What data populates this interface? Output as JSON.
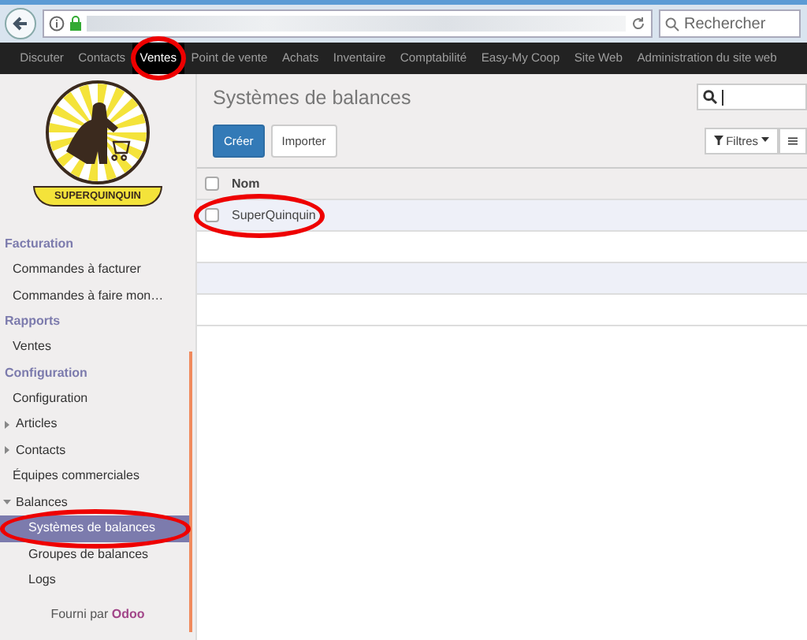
{
  "browser": {
    "search_placeholder": "Rechercher"
  },
  "navbar": {
    "items": [
      {
        "label": "Discuter",
        "selected": false,
        "circled": false
      },
      {
        "label": "Contacts",
        "selected": false,
        "circled": false
      },
      {
        "label": "Ventes",
        "selected": true,
        "circled": true
      },
      {
        "label": "Point de vente",
        "selected": false,
        "circled": false
      },
      {
        "label": "Achats",
        "selected": false,
        "circled": false
      },
      {
        "label": "Inventaire",
        "selected": false,
        "circled": false
      },
      {
        "label": "Comptabilité",
        "selected": false,
        "circled": false
      },
      {
        "label": "Easy-My Coop",
        "selected": false,
        "circled": false
      },
      {
        "label": "Site Web",
        "selected": false,
        "circled": false
      },
      {
        "label": "Administration du site web",
        "selected": false,
        "circled": false
      }
    ]
  },
  "sidebar": {
    "logo_text": "SUPERQUINQUIN",
    "sections": [
      {
        "title": "Facturation",
        "items": [
          {
            "label": "Commandes à facturer",
            "selected": false,
            "circled": false
          },
          {
            "label": "Commandes à faire mon…",
            "selected": false,
            "circled": false
          }
        ]
      },
      {
        "title": "Rapports",
        "items": [
          {
            "label": "Ventes",
            "selected": false,
            "circled": false
          }
        ]
      },
      {
        "title": "Configuration",
        "items": [
          {
            "label": "Configuration",
            "selected": false,
            "circled": false
          },
          {
            "label": "Articles",
            "selected": false,
            "circled": false,
            "expanded": false
          },
          {
            "label": "Contacts",
            "selected": false,
            "circled": false,
            "expanded": false
          },
          {
            "label": "Équipes commerciales",
            "selected": false,
            "circled": false
          },
          {
            "label": "Balances",
            "selected": false,
            "circled": false,
            "expanded": true,
            "children": [
              {
                "label": "Systèmes de balances",
                "selected": true,
                "circled": true
              },
              {
                "label": "Groupes de balances",
                "selected": false,
                "circled": false
              },
              {
                "label": "Logs",
                "selected": false,
                "circled": false
              }
            ]
          }
        ]
      }
    ],
    "footer": {
      "prefix": "Fourni par",
      "brand": "Odoo"
    }
  },
  "main": {
    "title": "Systèmes de balances",
    "buttons": [
      {
        "label": "Créer",
        "kind": "primary"
      },
      {
        "label": "Importer",
        "kind": "secondary"
      }
    ],
    "filters_label": "Filtres",
    "table": {
      "columns": [
        "Nom"
      ],
      "select_all_checked": false,
      "rows": [
        {
          "cells": [
            "SuperQuinquin"
          ],
          "checked": false,
          "circled": true
        }
      ]
    }
  }
}
